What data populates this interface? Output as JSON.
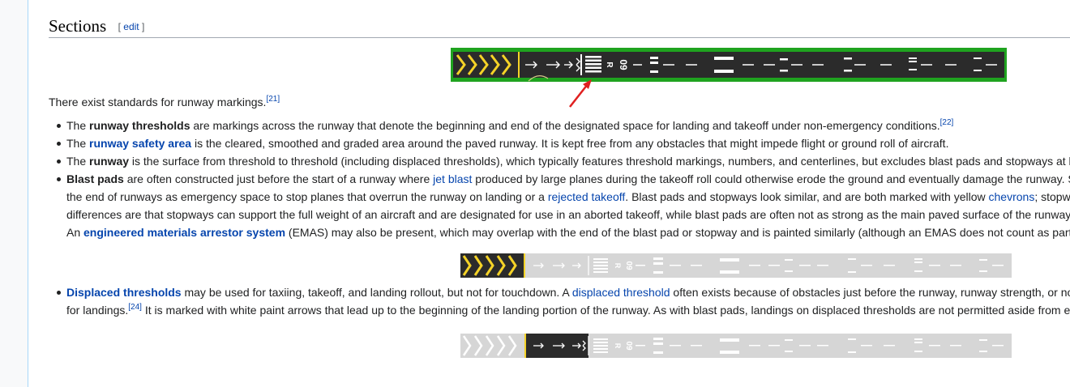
{
  "section": {
    "title": "Sections",
    "edit_open": "[ ",
    "edit_label": "edit",
    "edit_close": " ]"
  },
  "intro": {
    "text": "There exist standards for runway markings.",
    "ref": "[21]"
  },
  "items": [
    {
      "t1": "The ",
      "b1": "runway thresholds",
      "t2": " are markings across the runway that denote the beginning and end of the designated space for landing and takeoff under non-emergency conditions.",
      "ref": "[22]"
    },
    {
      "t1": "The ",
      "link": "runway safety area",
      "t2": " is the cleared, smoothed and graded area around the paved runway. It is kept free from any obstacles that might impede flight or ground roll of aircraft."
    },
    {
      "t1": "The ",
      "b1": "runway",
      "t2": " is the surface from threshold to threshold (including displaced thresholds), which typically features threshold markings, numbers, and centerlines, but excludes blast pads and stopways at b"
    },
    {
      "line1": {
        "b1": "Blast pads",
        "t1": " are often constructed just before the start of a runway where ",
        "link1": "jet blast",
        "t2": " produced by large planes during the takeoff roll could otherwise erode the ground and eventually damage the runway. S"
      },
      "line2": {
        "t1": "the end of runways as emergency space to stop planes that overrun the runway on landing or a ",
        "link1": "rejected takeoff",
        "t2": ". Blast pads and stopways look similar, and are both marked with yellow ",
        "link2": "chevrons",
        "t3": "; stopw"
      },
      "line3": {
        "t1": "differences are that stopways can support the full weight of an aircraft and are designated for use in an aborted takeoff, while blast pads are often not as strong as the main paved surface of the runway"
      },
      "line4": {
        "t1": "An ",
        "link1": "engineered materials arrestor system",
        "t2": " (EMAS) may also be present, which may overlap with the end of the blast pad or stopway and is painted similarly (although an EMAS does not count as part"
      }
    },
    {
      "line1": {
        "link1": "Displaced thresholds",
        "t1": " may be used for taxiing, takeoff, and landing rollout, but not for touchdown. A ",
        "link2": "displaced threshold",
        "t2": " often exists because of obstacles just before the runway, runway strength, or no"
      },
      "line2": {
        "t1": "for landings.",
        "ref": "[24]",
        "t2": " It is marked with white paint arrows that lead up to the beginning of the landing portion of the runway. As with blast pads, landings on displaced thresholds are not permitted aside from e"
      }
    }
  ],
  "runway": {
    "number": "09",
    "letter": "R"
  },
  "colors": {
    "link": "#0645ad",
    "grass": "#1fa31f",
    "chevron": "#f5d327",
    "asphalt": "#2b2b2b",
    "pale": "#d6d6d6"
  }
}
